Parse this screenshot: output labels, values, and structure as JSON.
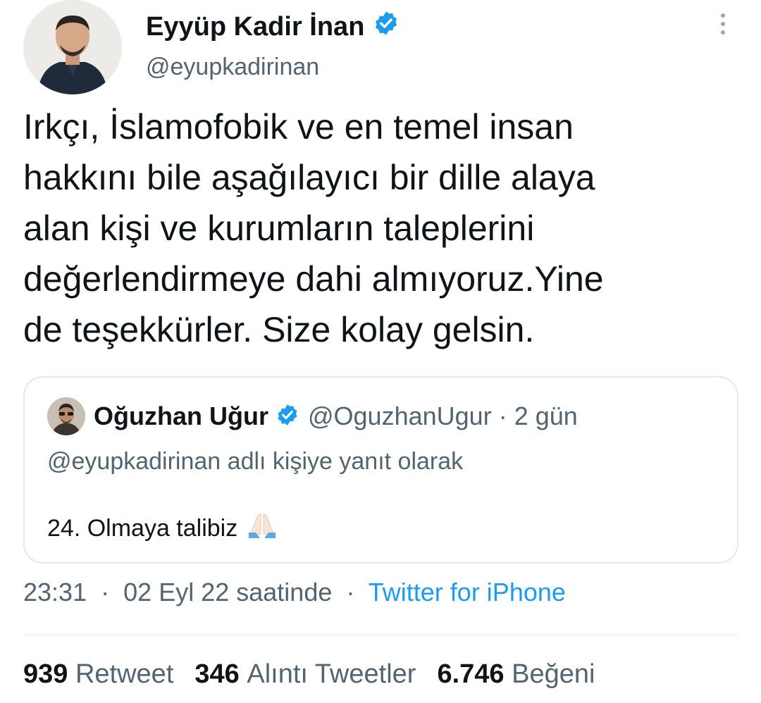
{
  "author": {
    "name": "Eyyüp Kadir İnan",
    "handle": "@eyupkadirinan",
    "verified": true
  },
  "tweet": {
    "text": "Irkçı, İslamofobik ve en temel insan\nhakkını bile aşağılayıcı bir dille alaya\nalan kişi ve kurumların taleplerini\ndeğerlendirmeye dahi almıyoruz.Yine\nde teşekkürler. Size kolay gelsin."
  },
  "quote": {
    "name": "Oğuzhan Uğur",
    "handle": "@OguzhanUgur",
    "separator": "·",
    "time": "2 gün",
    "reply_to": "@eyupkadirinan adlı kişiye yanıt olarak",
    "text": "24. Olmaya talibiz",
    "emoji": "folded-hands-icon"
  },
  "meta": {
    "time": "23:31",
    "separator": "·",
    "date": "02 Eyl 22 saatinde",
    "source": "Twitter for iPhone"
  },
  "stats": {
    "retweets_count": "939",
    "retweets_label": "Retweet",
    "quotes_count": "346",
    "quotes_label": "Alıntı Tweetler",
    "likes_count": "6.746",
    "likes_label": "Beğeni"
  },
  "colors": {
    "accent": "#1d9bf0",
    "text": "#0f1419",
    "secondary": "#536471",
    "border": "#e4e8eb"
  }
}
